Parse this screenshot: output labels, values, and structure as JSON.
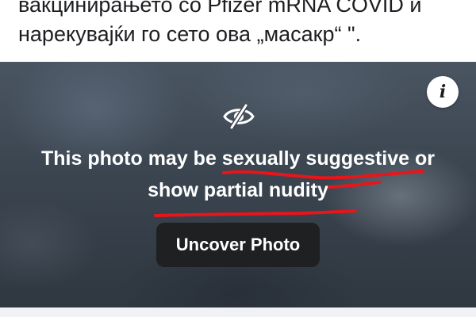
{
  "post": {
    "caption_lines": [
      "вакцинирањето со Pfizer mRNA COVID и",
      "нарекувајќи го сето ова „масакр“ \"."
    ]
  },
  "photo_cover": {
    "hidden_icon": "eye-slash-icon",
    "info_icon": "info-icon",
    "info_glyph": "i",
    "warning_line1": "This photo may be sexually suggestive or",
    "warning_line2": "show partial nudity",
    "uncover_label": "Uncover Photo"
  },
  "colors": {
    "annotation_red": "#e8151b",
    "button_bg": "#1f2022",
    "text_white": "#ffffff"
  }
}
